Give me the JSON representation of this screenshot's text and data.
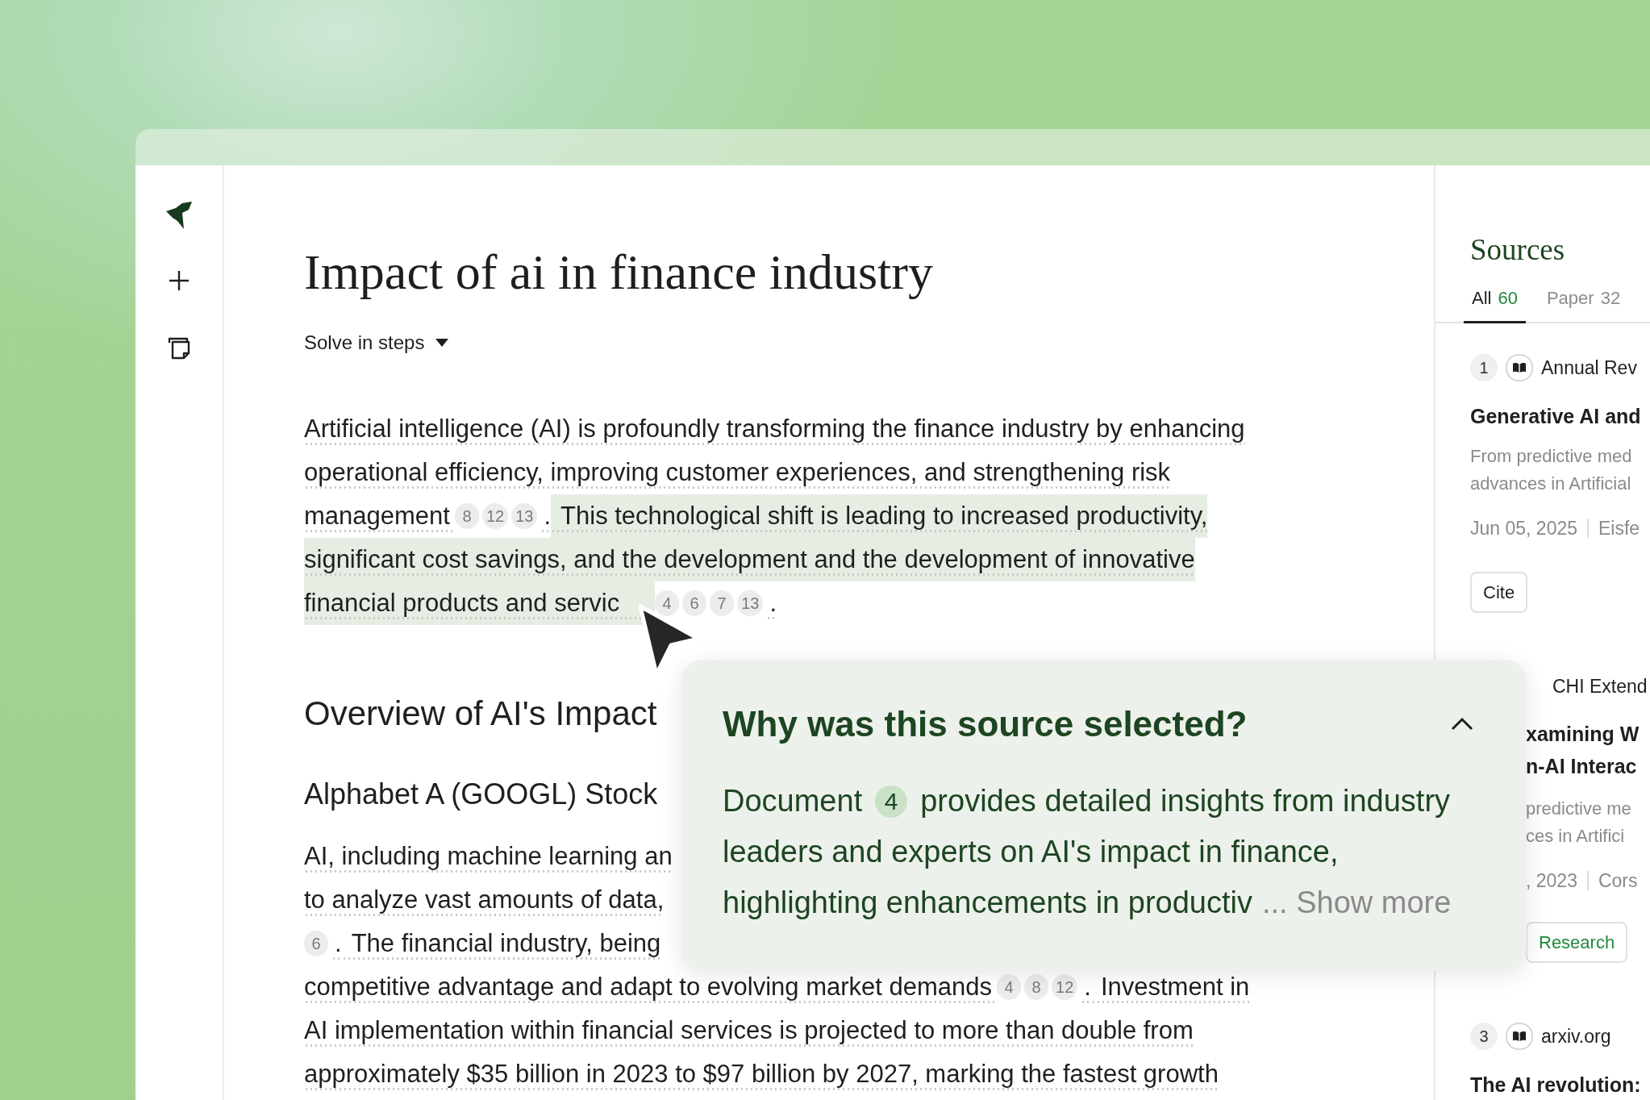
{
  "document": {
    "title": "Impact of ai in finance industry",
    "mode_dropdown": "Solve in steps",
    "blocks": [
      {
        "kind": "paragraph",
        "lines": [
          [
            {
              "kind": "text",
              "text": "Artificial intelligence (AI) is profoundly transforming the finance industry by enhancing",
              "highlighted": false
            }
          ],
          [
            {
              "kind": "text",
              "text": "operational efficiency, improving customer experiences, and strengthening risk",
              "highlighted": false
            }
          ],
          [
            {
              "kind": "text",
              "text": "management",
              "highlighted": false
            },
            {
              "kind": "cite",
              "text": "8"
            },
            {
              "kind": "cite",
              "text": "12"
            },
            {
              "kind": "cite",
              "text": "13"
            },
            {
              "kind": "text",
              "text": ".",
              "highlighted": false
            },
            {
              "kind": "text",
              "text": "This technological shift is leading to increased productivity,",
              "highlighted": true
            }
          ],
          [
            {
              "kind": "text",
              "text": "significant cost savings, and the development and the development of innovative",
              "highlighted": true
            }
          ],
          [
            {
              "kind": "text",
              "text": "financial products and servic",
              "highlighted": true
            },
            {
              "kind": "cite",
              "text": "4"
            },
            {
              "kind": "cite",
              "text": "6"
            },
            {
              "kind": "cite",
              "text": "7"
            },
            {
              "kind": "cite",
              "text": "13"
            },
            {
              "kind": "text",
              "text": ".",
              "highlighted": false
            }
          ]
        ]
      },
      {
        "kind": "heading",
        "text": "Overview of AI's Impact"
      },
      {
        "kind": "subheading",
        "text": "Alphabet A (GOOGL) Stock"
      },
      {
        "kind": "paragraph",
        "lines": [
          [
            {
              "kind": "text",
              "text": "AI, including machine learning an",
              "highlighted": false
            }
          ],
          [
            {
              "kind": "text",
              "text": "to analyze vast amounts of data,",
              "highlighted": false
            }
          ],
          [
            {
              "kind": "cite",
              "text": "6"
            },
            {
              "kind": "text",
              "text": ".",
              "highlighted": false
            },
            {
              "kind": "text",
              "text": "The financial industry, being",
              "highlighted": false
            }
          ],
          [
            {
              "kind": "text",
              "text": "competitive advantage and adapt to evolving market demands",
              "highlighted": false
            },
            {
              "kind": "cite",
              "text": "4"
            },
            {
              "kind": "cite",
              "text": "8"
            },
            {
              "kind": "cite",
              "text": "12"
            },
            {
              "kind": "text",
              "text": ".",
              "highlighted": false
            },
            {
              "kind": "text",
              "text": "Investment in",
              "highlighted": false
            }
          ],
          [
            {
              "kind": "text",
              "text": "AI implementation within financial services is projected to more than double from",
              "highlighted": false
            }
          ],
          [
            {
              "kind": "text",
              "text": "approximately $35 billion in 2023 to $97 billion by 2027, marking the fastest growth",
              "highlighted": false
            }
          ]
        ]
      }
    ]
  },
  "source_popup": {
    "title": "Why was this source selected?",
    "expanded": true,
    "lines": [
      [
        {
          "kind": "text",
          "text": "Document"
        },
        {
          "kind": "doc",
          "text": "4"
        },
        {
          "kind": "text",
          "text": "provides detailed insights from industry"
        }
      ],
      [
        {
          "kind": "text",
          "text": "leaders and experts on AI's impact in finance,"
        }
      ],
      [
        {
          "kind": "text",
          "text": "highlighting enhancements in productiv"
        }
      ]
    ],
    "show_more": "... Show more"
  },
  "sources": {
    "title": "Sources",
    "tabs": [
      {
        "label": "All",
        "count": "60",
        "selected": true
      },
      {
        "label": "Paper",
        "count": "32",
        "selected": false
      }
    ],
    "items": [
      {
        "kind": "full",
        "number": "1",
        "venue": "Annual Rev",
        "title_lines": [
          "Generative AI and"
        ],
        "snippet_lines": [
          "From predictive med",
          "advances in Artificial"
        ],
        "date": "Jun 05, 2025",
        "author": "Eisfe",
        "button": "Cite"
      },
      {
        "kind": "partial",
        "venue": "CHI Extend",
        "title_lines": [
          "xamining W",
          "n-AI Interac"
        ],
        "snippet_lines": [
          "predictive me",
          "ces in Artifici"
        ],
        "date": ", 2023",
        "author": "Cors",
        "tag": "Research"
      },
      {
        "kind": "full",
        "number": "3",
        "venue": "arxiv.org",
        "title_lines": [
          "The AI revolution:"
        ]
      }
    ]
  }
}
